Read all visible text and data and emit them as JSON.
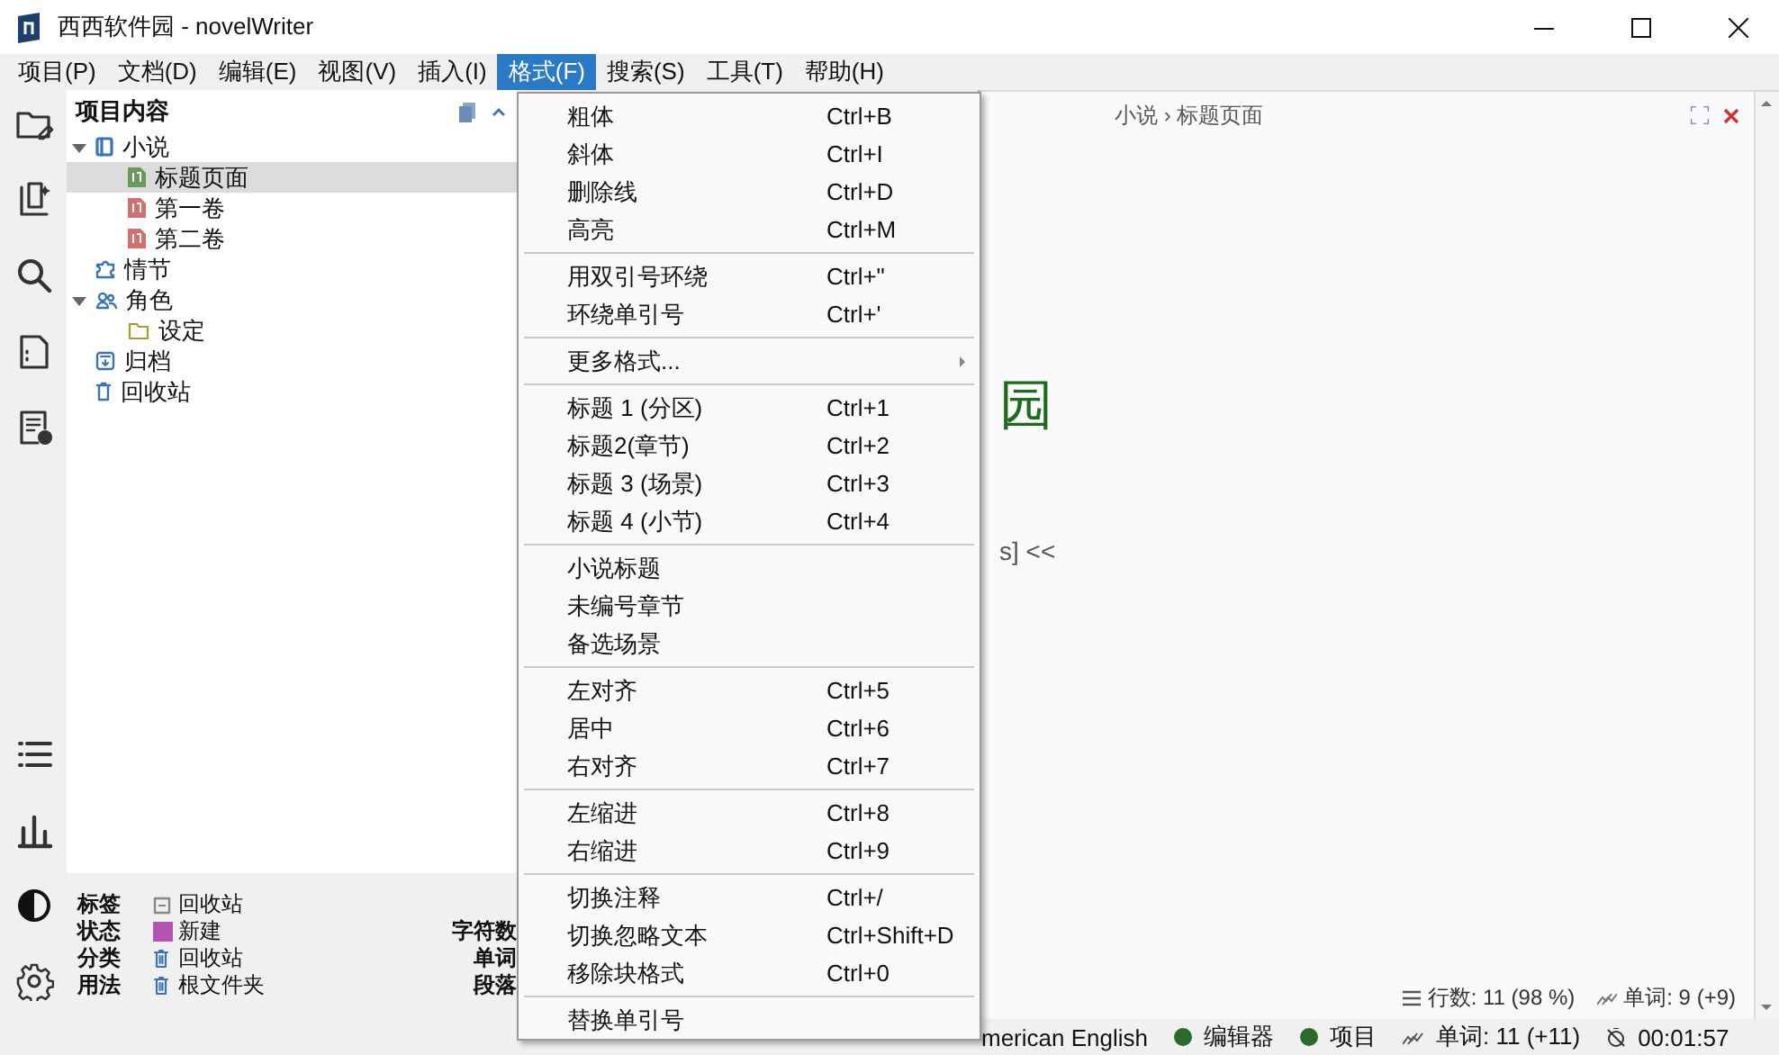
{
  "window": {
    "title": "西西软件园 - novelWriter"
  },
  "menu_bar": [
    {
      "label": "项目(P)",
      "selected": false
    },
    {
      "label": "文档(D)",
      "selected": false
    },
    {
      "label": "编辑(E)",
      "selected": false
    },
    {
      "label": "视图(V)",
      "selected": false
    },
    {
      "label": "插入(I)",
      "selected": false
    },
    {
      "label": "格式(F)",
      "selected": true
    },
    {
      "label": "搜索(S)",
      "selected": false
    },
    {
      "label": "工具(T)",
      "selected": false
    },
    {
      "label": "帮助(H)",
      "selected": false
    }
  ],
  "project_tree": {
    "title": "项目内容",
    "items": [
      {
        "label": "小说",
        "kind": "novel",
        "expanded": true,
        "selected": false,
        "children": [
          {
            "label": "标题页面",
            "kind": "document",
            "color": "#6a9a5b",
            "selected": true
          },
          {
            "label": "第一卷",
            "kind": "document",
            "color": "#d07070",
            "selected": false
          },
          {
            "label": "第二卷",
            "kind": "document",
            "color": "#d07070",
            "selected": false
          }
        ]
      },
      {
        "label": "情节",
        "kind": "plot",
        "selected": false
      },
      {
        "label": "角色",
        "kind": "characters",
        "expanded": true,
        "selected": false,
        "children": [
          {
            "label": "设定",
            "kind": "folder",
            "selected": false
          }
        ]
      },
      {
        "label": "归档",
        "kind": "archive",
        "selected": false
      },
      {
        "label": "回收站",
        "kind": "trash",
        "selected": false
      }
    ]
  },
  "details": {
    "rows": [
      {
        "label": "标签",
        "value": "回收站",
        "kind": "tag"
      },
      {
        "label": "状态",
        "value": "新建",
        "kind": "status",
        "color": "#b454b4"
      },
      {
        "label": "分类",
        "value": "回收站",
        "kind": "trash"
      },
      {
        "label": "用法",
        "value": "根文件夹",
        "kind": "trash"
      }
    ],
    "stats": [
      "字符数",
      "单词",
      "段落"
    ]
  },
  "format_menu": {
    "items": [
      {
        "kind": "item",
        "label": "粗体",
        "shortcut": "Ctrl+B"
      },
      {
        "kind": "item",
        "label": "斜体",
        "shortcut": "Ctrl+I"
      },
      {
        "kind": "item",
        "label": "删除线",
        "shortcut": "Ctrl+D"
      },
      {
        "kind": "item",
        "label": "高亮",
        "shortcut": "Ctrl+M"
      },
      {
        "kind": "separator"
      },
      {
        "kind": "item",
        "label": "用双引号环绕",
        "shortcut": "Ctrl+\""
      },
      {
        "kind": "item",
        "label": "环绕单引号",
        "shortcut": "Ctrl+'"
      },
      {
        "kind": "separator"
      },
      {
        "kind": "submenu",
        "label": "更多格式..."
      },
      {
        "kind": "separator"
      },
      {
        "kind": "item",
        "label": "标题 1 (分区)",
        "shortcut": "Ctrl+1"
      },
      {
        "kind": "item",
        "label": "标题2(章节)",
        "shortcut": "Ctrl+2"
      },
      {
        "kind": "item",
        "label": "标题 3 (场景)",
        "shortcut": "Ctrl+3"
      },
      {
        "kind": "item",
        "label": "标题 4 (小节)",
        "shortcut": "Ctrl+4"
      },
      {
        "kind": "separator"
      },
      {
        "kind": "item",
        "label": "小说标题"
      },
      {
        "kind": "item",
        "label": "未编号章节"
      },
      {
        "kind": "item",
        "label": "备选场景"
      },
      {
        "kind": "separator"
      },
      {
        "kind": "item",
        "label": "左对齐",
        "shortcut": "Ctrl+5"
      },
      {
        "kind": "item",
        "label": "居中",
        "shortcut": "Ctrl+6"
      },
      {
        "kind": "item",
        "label": "右对齐",
        "shortcut": "Ctrl+7"
      },
      {
        "kind": "separator"
      },
      {
        "kind": "item",
        "label": "左缩进",
        "shortcut": "Ctrl+8"
      },
      {
        "kind": "item",
        "label": "右缩进",
        "shortcut": "Ctrl+9"
      },
      {
        "kind": "separator"
      },
      {
        "kind": "item",
        "label": "切换注释",
        "shortcut": "Ctrl+/"
      },
      {
        "kind": "item",
        "label": "切换忽略文本",
        "shortcut": "Ctrl+Shift+D"
      },
      {
        "kind": "item",
        "label": "移除块格式",
        "shortcut": "Ctrl+0"
      },
      {
        "kind": "separator"
      },
      {
        "kind": "item",
        "label": "替换单引号"
      }
    ]
  },
  "editor": {
    "breadcrumb": "小说 › 标题页面",
    "title_fragment": "园",
    "line_fragment": "s] <<",
    "footer": {
      "lines": "行数: 11 (98 %)",
      "words": "单词: 9 (+9)"
    }
  },
  "status_bar": {
    "language": "merican English",
    "indicators": [
      {
        "label": "编辑器",
        "color": "#2a6a2a"
      },
      {
        "label": "项目",
        "color": "#2a6a2a"
      }
    ],
    "words": "单词: 11 (+11)",
    "session_time": "00:01:57"
  }
}
